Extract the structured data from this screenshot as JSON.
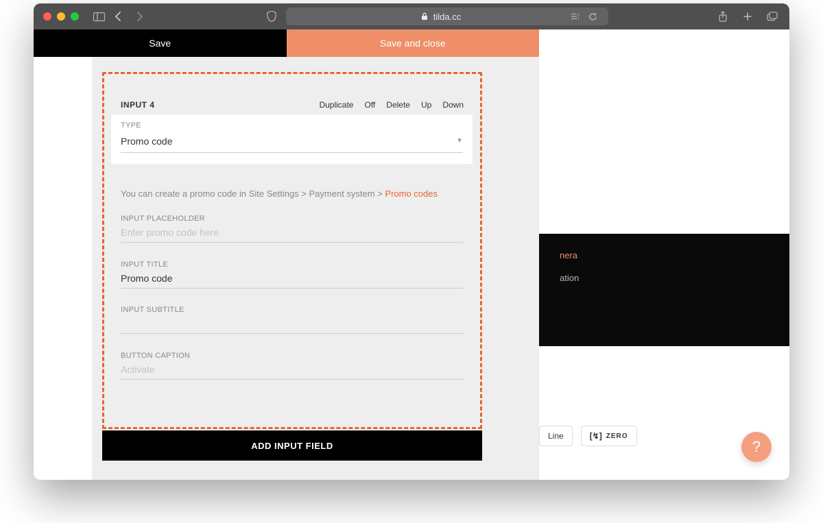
{
  "browser": {
    "url_host": "tilda.cc"
  },
  "topbar": {
    "save": "Save",
    "save_close": "Save and close"
  },
  "input_block": {
    "title": "INPUT 4",
    "actions": {
      "duplicate": "Duplicate",
      "off": "Off",
      "delete": "Delete",
      "up": "Up",
      "down": "Down"
    },
    "type_label": "TYPE",
    "type_value": "Promo code",
    "help_prefix": "You can create a promo code in Site Settings > Payment system > ",
    "help_link": "Promo codes",
    "fields": {
      "placeholder_label": "INPUT PLACEHOLDER",
      "placeholder_hint": "Enter promo code here",
      "title_label": "INPUT TITLE",
      "title_value": "Promo code",
      "subtitle_label": "INPUT SUBTITLE",
      "subtitle_value": "",
      "button_label": "BUTTON CAPTION",
      "button_hint": "Activate"
    },
    "add_button": "ADD INPUT FIELD"
  },
  "preview": {
    "line1": "nera",
    "line2": "ation"
  },
  "footer": {
    "line": "Line",
    "zero": "ZERO"
  },
  "help": "?"
}
